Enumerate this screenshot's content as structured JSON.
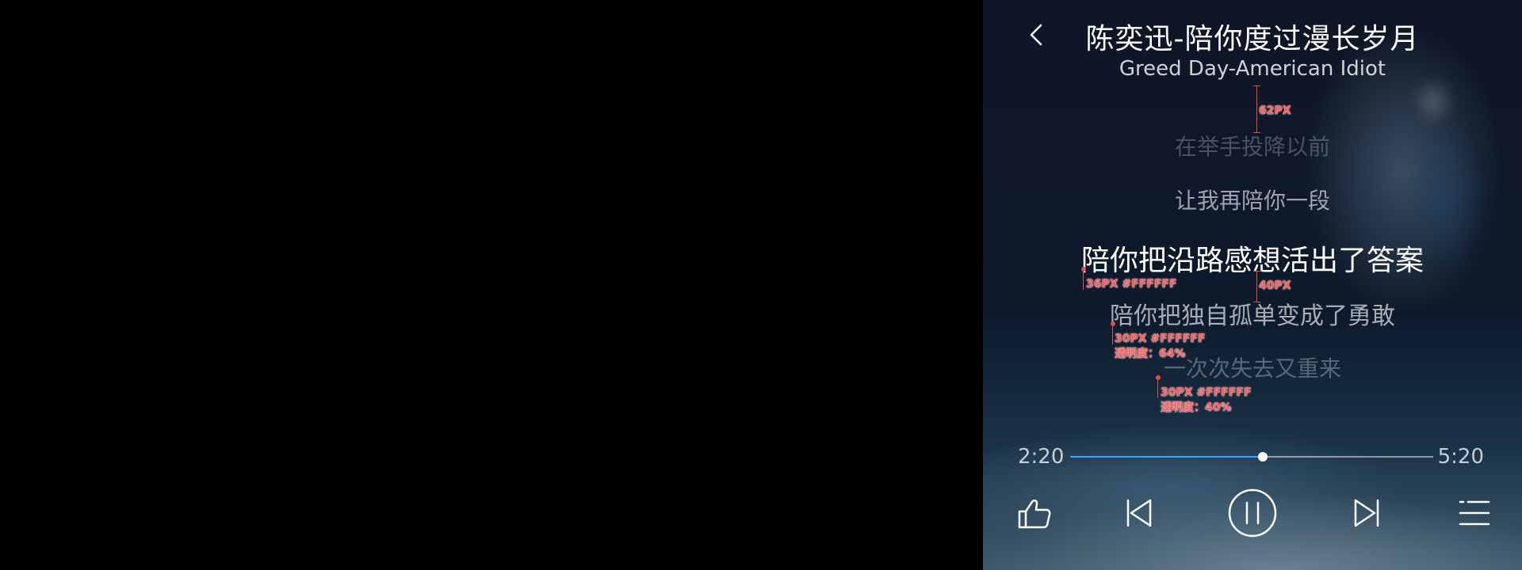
{
  "header": {
    "back_icon": "chevron-left-icon",
    "title": "陈奕迅-陪你度过漫长岁月",
    "subtitle": "Greed Day-American Idiot"
  },
  "lyrics": [
    {
      "text": "在举手投降以前",
      "state": "past"
    },
    {
      "text": "让我再陪你一段",
      "state": "past"
    },
    {
      "text": "陪你把沿路感想活出了答案",
      "state": "current"
    },
    {
      "text": "陪你把独自孤单变成了勇敢",
      "state": "next"
    },
    {
      "text": "一次次失去又重来",
      "state": "upcoming"
    }
  ],
  "annotations": {
    "gap_top": "62PX",
    "gap_lines": "40PX",
    "current_spec": "36PX #FFFFFF",
    "next_spec_size": "30PX #FFFFFF",
    "next_spec_opacity": "透明度：64%",
    "upcoming_spec_size": "30PX #FFFFFF",
    "upcoming_spec_opacity": "透明度：40%"
  },
  "playback": {
    "elapsed": "2:20",
    "duration": "5:20",
    "progress": 0.53,
    "accent_color": "#3da1ff"
  },
  "controls": {
    "like_icon": "thumbs-up-icon",
    "prev_icon": "skip-previous-icon",
    "pause_icon": "pause-circle-icon",
    "next_icon": "skip-next-icon",
    "list_icon": "playlist-icon"
  }
}
